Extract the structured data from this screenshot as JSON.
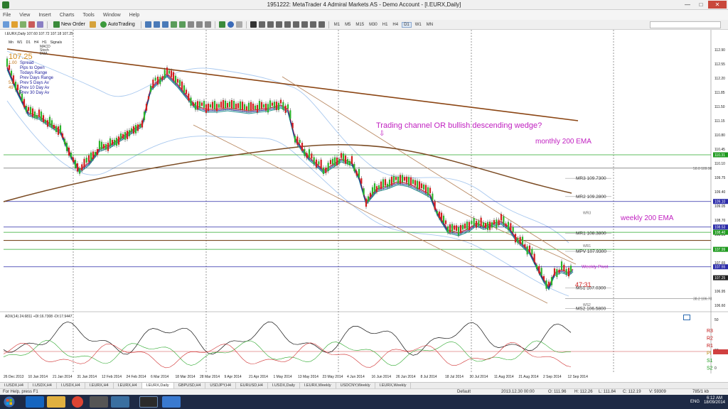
{
  "window": {
    "title": "1951222: MetaTrader 4 Admiral Markets AS - Demo Account - [I.EURX,Daily]"
  },
  "menu": [
    "File",
    "View",
    "Insert",
    "Charts",
    "Tools",
    "Window",
    "Help"
  ],
  "toolbar": {
    "new_order": "New Order",
    "autotrading": "AutoTrading",
    "timeframes": [
      "M1",
      "M5",
      "M15",
      "M30",
      "H1",
      "H4",
      "D1",
      "W1",
      "MN"
    ],
    "active_timeframe": "D1"
  },
  "chart": {
    "header": "I.EURX,Daily  107.60 107.72 107.18 107.25",
    "signals_row": [
      "Mn",
      "W1",
      "D1",
      "H4",
      "H1",
      "Signals"
    ],
    "indicator_legend": [
      "MACD",
      "Stoch",
      "EMA"
    ],
    "price_big": "107.25",
    "info_panel": [
      {
        "num": "1.00",
        "label": "Spread"
      },
      {
        "num": "",
        "label": "Pips to Open"
      },
      {
        "num": "",
        "label": "Todays Range"
      },
      {
        "num": "",
        "label": "Prev Days Range"
      },
      {
        "num": "51",
        "label": "Prev 5 Days Av"
      },
      {
        "num": "49",
        "label": "Prev 10 Day Av"
      },
      {
        "num": "",
        "label": "Prev 30 Day Av"
      }
    ],
    "annotation_title": "Trading channel OR bullish descending wedge?",
    "annotation_arrow": "⇩",
    "monthly_label": "monthly 200 EMA",
    "weekly_label": "weekly 200 EMA",
    "timer": "47:31",
    "pivot_labels": [
      {
        "text": "50.0  109.98",
        "price": 109.98
      },
      {
        "text": "MR3  109.7300",
        "price": 109.73
      },
      {
        "text": "MR2  109.2800",
        "price": 109.28
      },
      {
        "text": "WR3",
        "price": 108.88
      },
      {
        "text": "MR1  108.3800",
        "price": 108.38
      },
      {
        "text": "WR1",
        "price": 108.07
      },
      {
        "text": "MPV  107.9300",
        "price": 107.93
      },
      {
        "text": "Weekly Pivot",
        "price": 107.55
      },
      {
        "text": "MS1  107.0300",
        "price": 107.03
      },
      {
        "text": "38.2  106.73",
        "price": 106.77
      },
      {
        "text": "WS2",
        "price": 106.62
      },
      {
        "text": "MS2  106.5800",
        "price": 106.52
      }
    ],
    "price_axis": [
      "112.90",
      "112.55",
      "112.20",
      "111.85",
      "111.50",
      "111.15",
      "110.80",
      "110.45",
      "110.10",
      "109.75",
      "109.40",
      "109.05",
      "108.70",
      "108.35",
      "108.00",
      "107.65",
      "107.30",
      "106.95",
      "106.60"
    ],
    "price_tags": [
      {
        "text": "110.31",
        "price": 110.31,
        "color": "#1e9a1e"
      },
      {
        "text": "109.10",
        "price": 109.16,
        "color": "#2a2aa8"
      },
      {
        "text": "108.53",
        "price": 108.53,
        "color": "#2a2aa8"
      },
      {
        "text": "108.40",
        "price": 108.4,
        "color": "#1e9a1e"
      },
      {
        "text": "107.99",
        "price": 107.98,
        "color": "#1e9a1e"
      },
      {
        "text": "107.55",
        "price": 107.55,
        "color": "#2a2aa8"
      }
    ],
    "date_axis": [
      "26 Dec 2013",
      "10 Jan 2014",
      "21 Jan 2014",
      "31 Jan 2014",
      "12 Feb 2014",
      "24 Feb 2014",
      "6 Mar 2014",
      "18 Mar 2014",
      "28 Mar 2014",
      "9 Apr 2014",
      "21 Apr 2014",
      "1 May 2014",
      "13 May 2014",
      "23 May 2014",
      "4 Jun 2014",
      "16 Jun 2014",
      "26 Jun 2014",
      "8 Jul 2014",
      "18 Jul 2014",
      "30 Jul 2014",
      "11 Aug 2014",
      "21 Aug 2014",
      "2 Sep 2014",
      "12 Sep 2014"
    ],
    "adx_header": "ADX(14) 24.6811 +DI:16.7308 -DI:17.9447",
    "adx_axis": [
      "50",
      "27",
      "0"
    ],
    "pivot_legend": [
      "R3",
      "R2",
      "R1",
      "Pi",
      "S1",
      "S2"
    ]
  },
  "tabs": [
    {
      "label": "I.USDX,H4",
      "active": false
    },
    {
      "label": "I.USDX,H4",
      "active": false
    },
    {
      "label": "I.USDX,H4",
      "active": false
    },
    {
      "label": "I.EURX,H4",
      "active": false
    },
    {
      "label": "I.EURX,H4",
      "active": false
    },
    {
      "label": "I.EURX,Daily",
      "active": true
    },
    {
      "label": "GBPUSD,H4",
      "active": false
    },
    {
      "label": "USDJPY,H4",
      "active": false
    },
    {
      "label": "EURUSD,H4",
      "active": false
    },
    {
      "label": "I.USDX,Daily",
      "active": false
    },
    {
      "label": "I.EURX,Weekly",
      "active": false
    },
    {
      "label": "USDCNY,Weekly",
      "active": false
    },
    {
      "label": "I.EURX,Weekly",
      "active": false
    }
  ],
  "status": {
    "help": "For Help, press F1",
    "profile": "Default",
    "datetime": "2013.12.30 00:00",
    "open": "O: 111.96",
    "high": "H: 112.26",
    "low": "L: 111.84",
    "close": "C: 112.19",
    "volume": "V: 59309",
    "traffic": "785/1 kb"
  },
  "taskbar": {
    "lang": "ENG",
    "time": "6:12 AM",
    "date": "18/09/2014"
  }
}
